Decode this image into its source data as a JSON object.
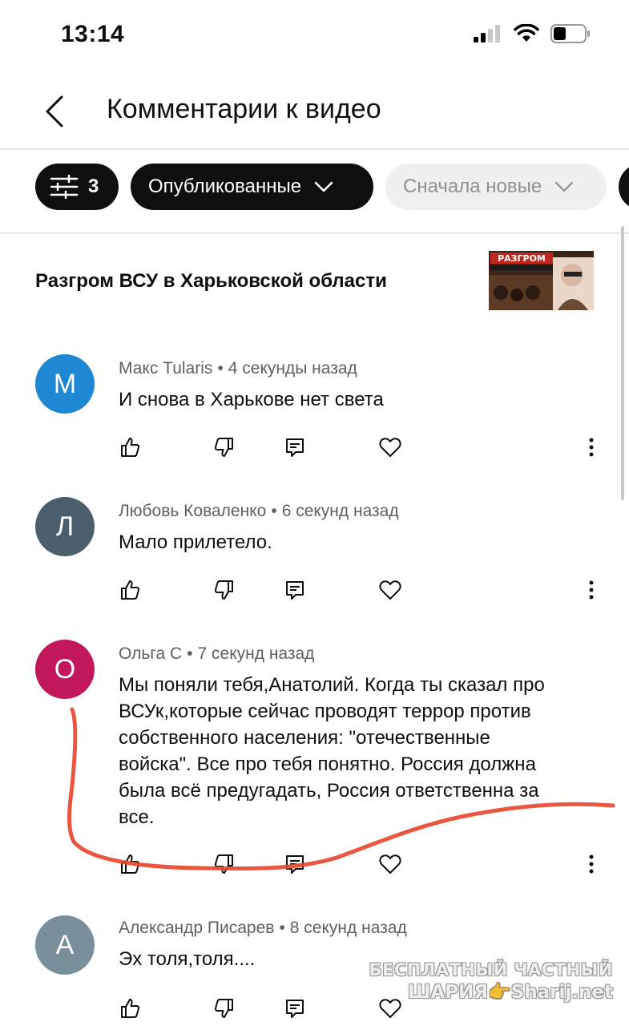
{
  "status": {
    "time": "13:14"
  },
  "header": {
    "title": "Комментарии к видео"
  },
  "chips": {
    "filter_count": "3",
    "published": "Опубликованные",
    "sort": "Сначала новые"
  },
  "video": {
    "title": "Разгром ВСУ в Харьковской области",
    "thumb_text": "РАЗГРОМ"
  },
  "comments": [
    {
      "initial": "М",
      "color": "#1e88d2",
      "author": "Макс Tularis",
      "time": "4 секунды назад",
      "text": "И снова в Харькове нет света"
    },
    {
      "initial": "Л",
      "color": "#4a5e6b",
      "author": "Любовь Коваленко",
      "time": "6 секунд назад",
      "text": "Мало прилетело."
    },
    {
      "initial": "О",
      "color": "#c2185b",
      "author": "Ольга С",
      "time": "7 секунд назад",
      "lines": [
        "Мы поняли тебя,Анатолий. Когда ты сказал про",
        "ВСУк,которые сейчас проводят террор против",
        "собственного населения: \"отечественные",
        "войска\". Все про тебя понятно. Россия должна",
        "была всё предугадать, Россия ответственна за",
        "все."
      ]
    },
    {
      "initial": "А",
      "color": "#7a8f9c",
      "author": "Александр Писарев",
      "time": "8 секунд назад",
      "text": "Эх толя,толя...."
    }
  ],
  "watermark": {
    "line1": "БЕСПЛАТНЫЙ ЧАСТНЫЙ",
    "line2": "ШАРИЯ👉Sharij.net"
  },
  "colors": {
    "annotation": "#e8452c",
    "text_secondary": "#606060"
  }
}
